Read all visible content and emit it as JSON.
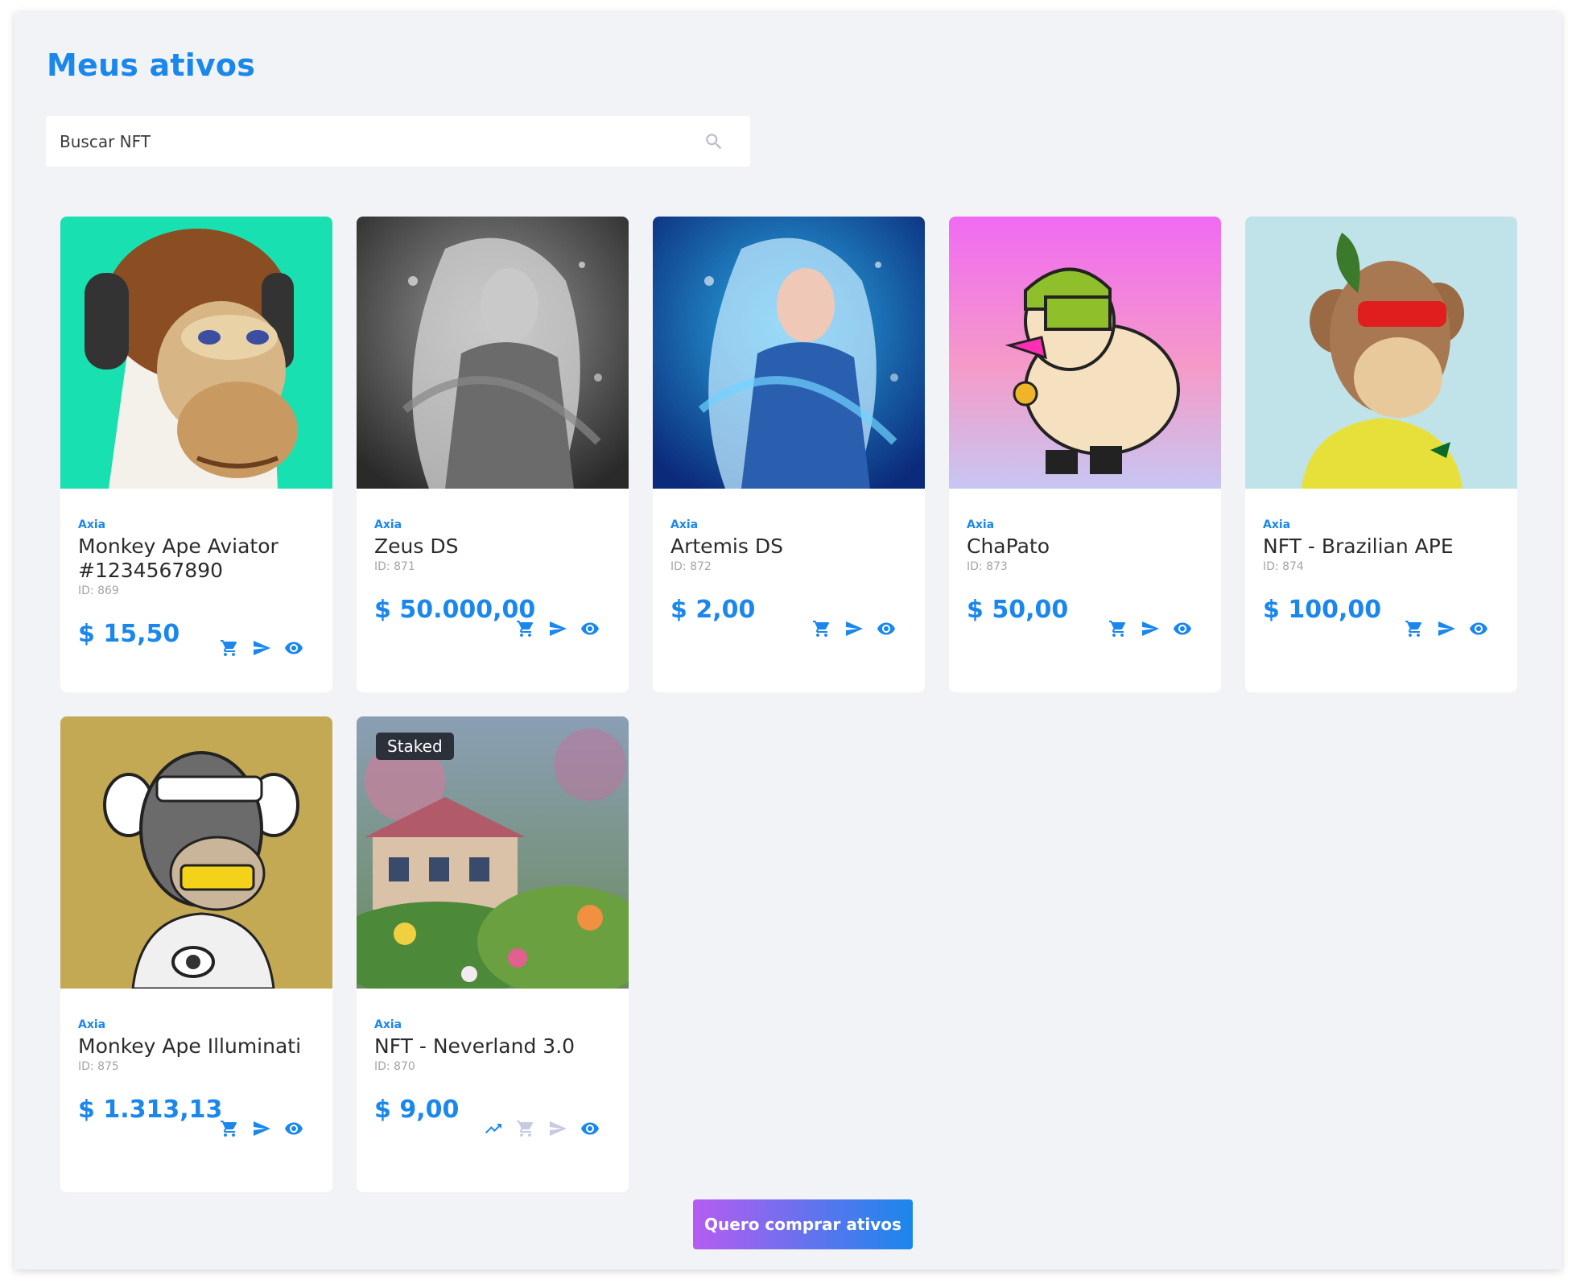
{
  "page": {
    "title": "Meus ativos"
  },
  "search": {
    "placeholder": "Buscar NFT"
  },
  "nfts": [
    {
      "brand": "Axia",
      "name": "Monkey Ape Aviator #1234567890",
      "id": "ID: 869",
      "price": "$ 15,50",
      "badge": "",
      "art": "ape-aviator",
      "bg": "#19e0b0"
    },
    {
      "brand": "Axia",
      "name": "Zeus DS",
      "id": "ID: 871",
      "price": "$ 50.000,00",
      "badge": "",
      "art": "zeus",
      "bg": "#5a5a5a"
    },
    {
      "brand": "Axia",
      "name": "Artemis DS",
      "id": "ID: 872",
      "price": "$ 2,00",
      "badge": "",
      "art": "artemis",
      "bg": "#1e5fb8"
    },
    {
      "brand": "Axia",
      "name": "ChaPato",
      "id": "ID: 873",
      "price": "$ 50,00",
      "badge": "",
      "art": "duck",
      "bg": "#f070f0"
    },
    {
      "brand": "Axia",
      "name": "NFT - Brazilian APE",
      "id": "ID: 874",
      "price": "$ 100,00",
      "badge": "",
      "art": "ape-brazil",
      "bg": "#bfe3e8"
    },
    {
      "brand": "Axia",
      "name": "Monkey Ape Illuminati",
      "id": "ID: 875",
      "price": "$ 1.313,13",
      "badge": "",
      "art": "ape-illuminati",
      "bg": "#c4a955"
    },
    {
      "brand": "Axia",
      "name": "NFT - Neverland 3.0",
      "id": "ID: 870",
      "price": "$ 9,00",
      "badge": "Staked",
      "art": "neverland",
      "bg": "#7a8ea0"
    }
  ],
  "buy_button": {
    "label": "Quero comprar ativos"
  },
  "colors": {
    "accent": "#1a87ec",
    "disabled": "#c8cbe0",
    "gradient_start": "#b65cf0"
  }
}
